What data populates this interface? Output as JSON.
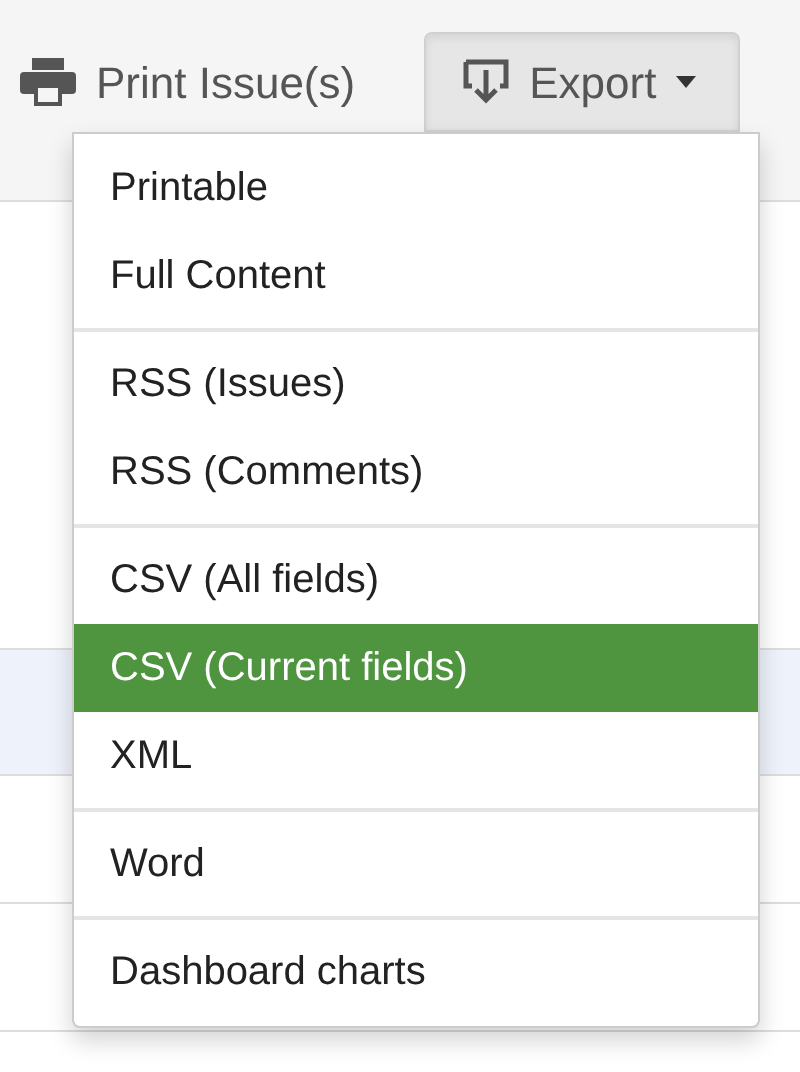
{
  "toolbar": {
    "buttons": [
      {
        "kind": "print",
        "label": "Print Issue(s)"
      },
      {
        "kind": "export",
        "label": "Export",
        "expanded": true
      }
    ]
  },
  "export_menu": {
    "groups": [
      {
        "items": [
          {
            "label": "Printable",
            "selected": false
          },
          {
            "label": "Full Content",
            "selected": false
          }
        ]
      },
      {
        "items": [
          {
            "label": "RSS (Issues)",
            "selected": false
          },
          {
            "label": "RSS (Comments)",
            "selected": false
          }
        ]
      },
      {
        "items": [
          {
            "label": "CSV (All fields)",
            "selected": false
          },
          {
            "label": "CSV (Current fields)",
            "selected": true
          },
          {
            "label": "XML",
            "selected": false
          }
        ]
      },
      {
        "items": [
          {
            "label": "Word",
            "selected": false
          }
        ]
      },
      {
        "items": [
          {
            "label": "Dashboard charts",
            "selected": false
          }
        ]
      }
    ]
  }
}
